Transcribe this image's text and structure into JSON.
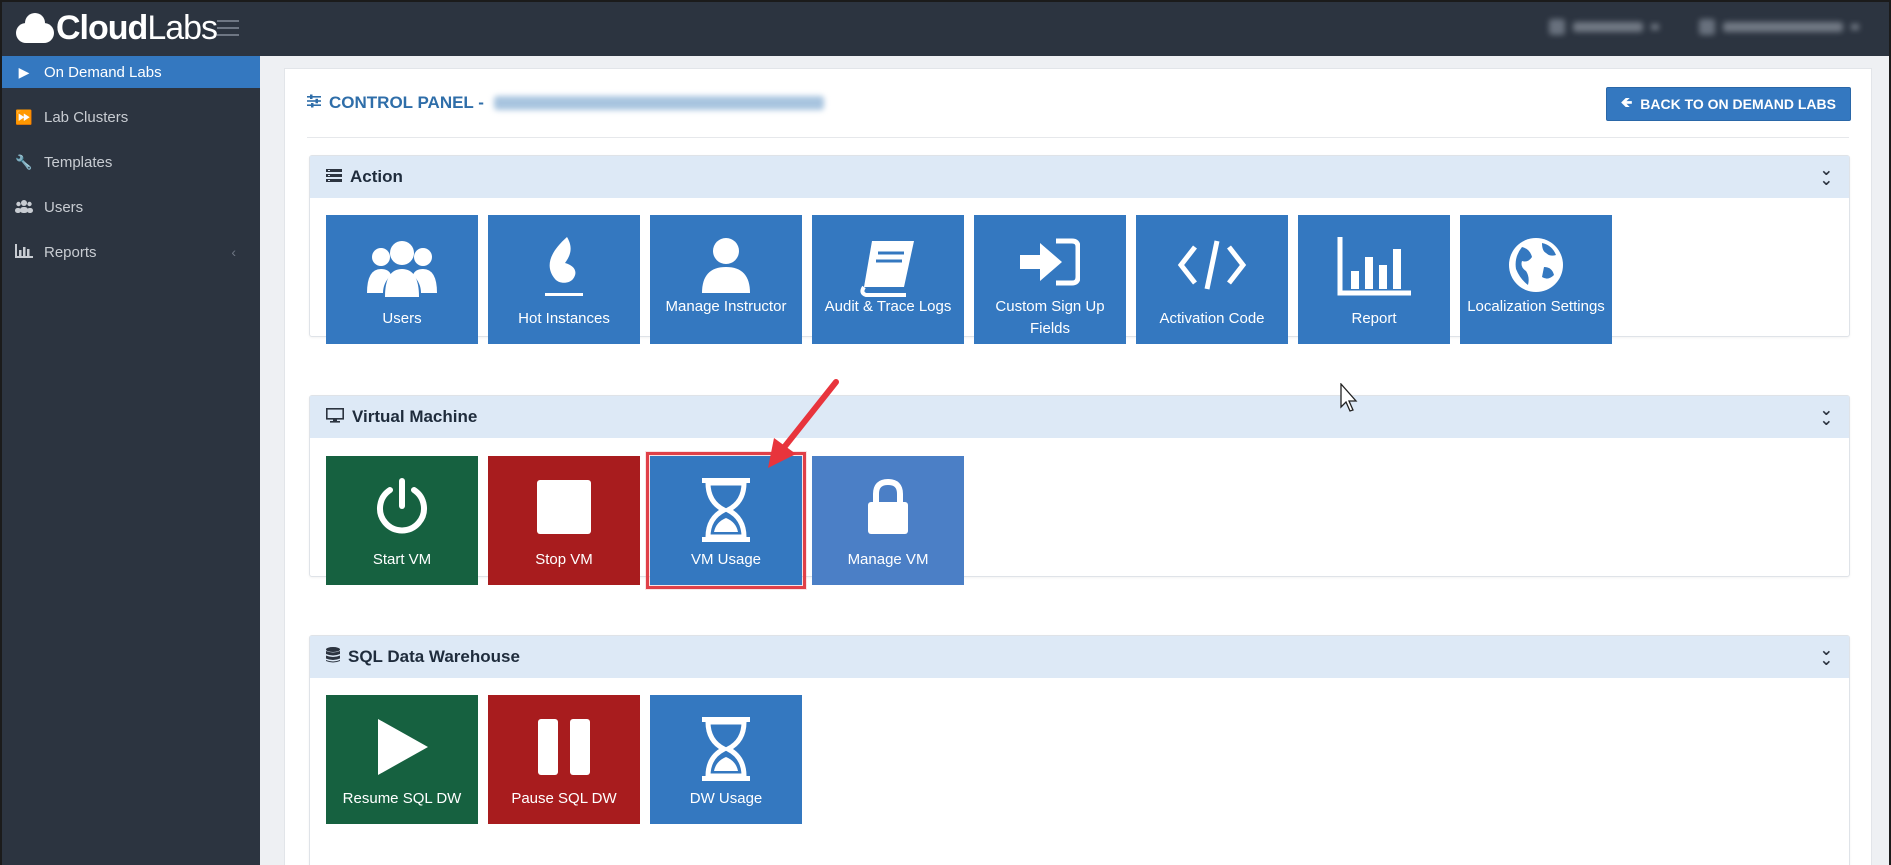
{
  "header": {
    "logo_bold": "Cloud",
    "logo_light": "Labs",
    "user_menu_1": "",
    "user_menu_2": ""
  },
  "sidebar": {
    "items": [
      {
        "label": "On Demand Labs",
        "icon": "play-icon",
        "active": true
      },
      {
        "label": "Lab Clusters",
        "icon": "fast-forward-icon",
        "active": false
      },
      {
        "label": "Templates",
        "icon": "wrench-icon",
        "active": false
      },
      {
        "label": "Users",
        "icon": "users-icon",
        "active": false
      },
      {
        "label": "Reports",
        "icon": "bar-chart-icon",
        "active": false
      }
    ]
  },
  "main": {
    "title": "CONTROL PANEL -",
    "back_label": "BACK TO ON DEMAND LABS",
    "sections": [
      {
        "title": "Action",
        "tiles": [
          {
            "label": "Users",
            "icon": "users-icon"
          },
          {
            "label": "Hot Instances",
            "icon": "flame-icon"
          },
          {
            "label": "Manage Instructor",
            "icon": "user-icon"
          },
          {
            "label": "Audit & Trace Logs",
            "icon": "book-icon"
          },
          {
            "label": "Custom Sign Up Fields",
            "icon": "sign-in-icon"
          },
          {
            "label": "Activation Code",
            "icon": "code-icon"
          },
          {
            "label": "Report",
            "icon": "bar-chart-icon"
          },
          {
            "label": "Localization Settings",
            "icon": "globe-icon"
          }
        ]
      },
      {
        "title": "Virtual Machine",
        "tiles": [
          {
            "label": "Start VM",
            "icon": "power-icon"
          },
          {
            "label": "Stop VM",
            "icon": "stop-icon"
          },
          {
            "label": "VM Usage",
            "icon": "hourglass-icon",
            "highlighted": true
          },
          {
            "label": "Manage VM",
            "icon": "lock-icon"
          }
        ]
      },
      {
        "title": "SQL Data Warehouse",
        "tiles": [
          {
            "label": "Resume SQL DW",
            "icon": "play-icon"
          },
          {
            "label": "Pause SQL DW",
            "icon": "pause-icon"
          },
          {
            "label": "DW Usage",
            "icon": "hourglass-icon"
          }
        ]
      }
    ]
  },
  "colors": {
    "sidebar_bg": "#2c3440",
    "accent_blue": "#3478c0",
    "green": "#166140",
    "red": "#a81c1e",
    "highlight": "#e04048"
  }
}
